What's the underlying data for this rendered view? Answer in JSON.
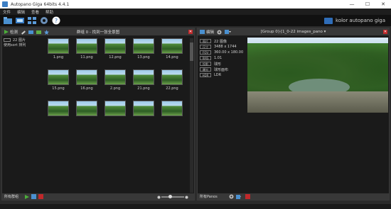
{
  "window": {
    "title": "Autopano Giga 64bits 4.4.1",
    "controls": [
      "—",
      "☐",
      "✕"
    ]
  },
  "menu": [
    "文件",
    "编辑",
    "查看",
    "帮助"
  ],
  "brand": {
    "text": "kolor autopano giga"
  },
  "left_panel": {
    "detect_label": "检测",
    "title": "群组 0 - 找到一张全景图",
    "group_list": [
      {
        "label": "22 图片"
      },
      {
        "label": "使用sort 排列"
      }
    ],
    "thumbnails": [
      "1.png",
      "11.png",
      "12.png",
      "13.png",
      "14.png",
      "15.png",
      "16.png",
      "2.png",
      "21.png",
      "22.png",
      "",
      "",
      "",
      "",
      ""
    ],
    "footer_label": "所有群组"
  },
  "right_panel": {
    "edit_label": "编辑",
    "title": "[Group 0]-[1_0-22 images_pano ▾",
    "info": [
      {
        "tag": "图片",
        "value": "22 图像"
      },
      {
        "tag": "尺寸",
        "value": "3488 x 1744"
      },
      {
        "tag": "FOV",
        "value": "360.00 x 180.00"
      },
      {
        "tag": "RMS",
        "value": "1.01"
      },
      {
        "tag": "投影",
        "value": "球形"
      },
      {
        "tag": "曝光",
        "value": "球形面布"
      },
      {
        "tag": "HDR",
        "value": "LDR"
      }
    ],
    "footer_label": "所有Panos"
  },
  "colors": {
    "accent_green": "#4caf3a",
    "close_red": "#c0282a",
    "logo_blue": "#2f6db8"
  }
}
